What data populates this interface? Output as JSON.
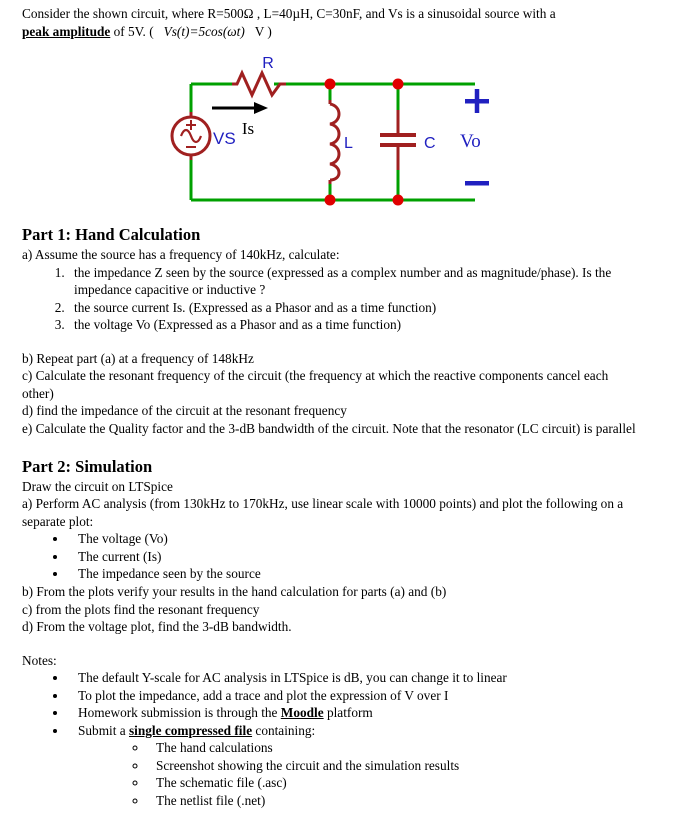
{
  "intro": {
    "line1_pre": "Consider the shown circuit, where R=500Ω , L=40µH, C=30nF, and Vs is a sinusoidal source with a",
    "peak_amplitude": "peak amplitude",
    "line2_mid": " of 5V. (",
    "formula": "Vs(t)=5cos(ωt)",
    "line2_unit": "V )"
  },
  "circuit": {
    "labels": {
      "resistor": "R",
      "source": "VS",
      "current": "Is",
      "inductor": "L",
      "capacitor": "C",
      "output": "Vo",
      "plus": "+",
      "minus": "−",
      "source_plus": "+",
      "source_minus": "−"
    },
    "colors": {
      "wire": "#00a000",
      "component": "#a02020",
      "node": "#e00000",
      "label": "#2020c0",
      "arrow": "#000000"
    }
  },
  "part1": {
    "heading": "Part 1: Hand Calculation",
    "a_intro": "a) Assume the source has a frequency of 140kHz, calculate:",
    "items": [
      "the impedance Z seen by the source (expressed as a complex number and as magnitude/phase). Is the impedance capacitive or inductive ?",
      "the source current Is. (Expressed as a Phasor and as a time function)",
      "the voltage Vo (Expressed as a Phasor and as a time function)"
    ],
    "b": "b) Repeat part (a) at a frequency of 148kHz",
    "c": "c) Calculate the resonant frequency of the circuit (the frequency at which the reactive components cancel each other)",
    "d": "d) find the impedance of the circuit at the resonant frequency",
    "e": "e) Calculate the Quality factor and the 3-dB bandwidth of the circuit. Note that the resonator (LC circuit) is parallel"
  },
  "part2": {
    "heading": "Part 2: Simulation",
    "draw": "Draw the circuit on LTSpice",
    "a_intro": "a) Perform AC analysis (from 130kHz to 170kHz, use linear scale with 10000 points) and plot the following on a separate plot:",
    "plots": [
      "The voltage (Vo)",
      "The current (Is)",
      "The impedance seen by the source"
    ],
    "b": "b) From the plots verify your results in the hand calculation for parts (a) and (b)",
    "c": "c) from the plots find the resonant frequency",
    "d": "d) From the voltage plot, find the 3-dB bandwidth."
  },
  "notes": {
    "heading": "Notes:",
    "item1": "The default Y-scale for AC analysis in LTSpice is dB, you can change it to linear",
    "item2": "To plot the impedance, add a trace and plot the expression of V over I",
    "item3_pre": "Homework submission is through the ",
    "item3_link": "Moodle",
    "item3_post": " platform",
    "item4_pre": "Submit a ",
    "item4_link": "single compressed file",
    "item4_post": " containing:",
    "subitems": [
      "The hand calculations",
      "Screenshot showing the circuit and the simulation results",
      "The schematic file (.asc)",
      "The netlist file (.net)"
    ]
  }
}
